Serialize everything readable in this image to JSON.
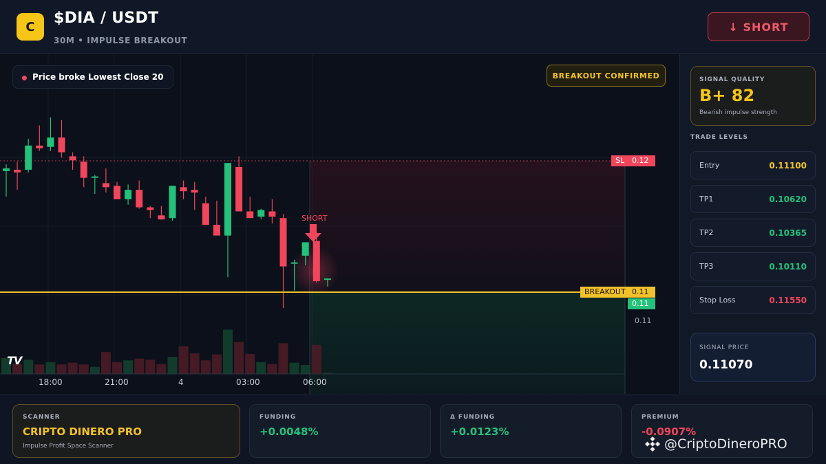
{
  "header": {
    "logo_letter": "C",
    "pair": "$DIA / USDT",
    "subtitle": "30M • IMPULSE BREAKOUT",
    "action_label": "↓ SHORT"
  },
  "chart": {
    "info_text": "Price broke Lowest Close 20",
    "confirm_badge": "BREAKOUT CONFIRMED",
    "sl_name": "SL",
    "sl_value": "0.12",
    "breakout_name": "BREAKOUT",
    "breakout_value": "0.11",
    "current_value": "0.11",
    "axis_value": "0.11",
    "short_marker": "SHORT",
    "tv_logo": "TV",
    "time_labels": [
      "18:00",
      "21:00",
      "4",
      "03:00",
      "06:00"
    ],
    "colors": {
      "up": "#24c17a",
      "down": "#f0465c",
      "breakout": "#f2c22b"
    }
  },
  "chart_data": {
    "type": "candlestick",
    "note_ohlc": "approximate candle and volume values",
    "candles": [
      {
        "o": 0.1159,
        "h": 0.1164,
        "l": 0.114,
        "c": 0.1161
      },
      {
        "o": 0.116,
        "h": 0.1166,
        "l": 0.1145,
        "c": 0.1158
      },
      {
        "o": 0.116,
        "h": 0.1183,
        "l": 0.1158,
        "c": 0.1178
      },
      {
        "o": 0.1178,
        "h": 0.1193,
        "l": 0.1174,
        "c": 0.1176
      },
      {
        "o": 0.1177,
        "h": 0.1199,
        "l": 0.1174,
        "c": 0.1184
      },
      {
        "o": 0.1184,
        "h": 0.1197,
        "l": 0.1169,
        "c": 0.1173
      },
      {
        "o": 0.117,
        "h": 0.1173,
        "l": 0.116,
        "c": 0.1167
      },
      {
        "o": 0.1166,
        "h": 0.117,
        "l": 0.1147,
        "c": 0.1154
      },
      {
        "o": 0.1154,
        "h": 0.1156,
        "l": 0.1142,
        "c": 0.1155
      },
      {
        "o": 0.115,
        "h": 0.1161,
        "l": 0.1143,
        "c": 0.1147
      },
      {
        "o": 0.1148,
        "h": 0.1151,
        "l": 0.1139,
        "c": 0.1138
      },
      {
        "o": 0.1138,
        "h": 0.1149,
        "l": 0.1134,
        "c": 0.1145
      },
      {
        "o": 0.1145,
        "h": 0.1152,
        "l": 0.1131,
        "c": 0.1132
      },
      {
        "o": 0.1132,
        "h": 0.1133,
        "l": 0.1124,
        "c": 0.113
      },
      {
        "o": 0.1126,
        "h": 0.1133,
        "l": 0.1123,
        "c": 0.1123
      },
      {
        "o": 0.1124,
        "h": 0.1142,
        "l": 0.1122,
        "c": 0.1148
      },
      {
        "o": 0.1147,
        "h": 0.1152,
        "l": 0.1138,
        "c": 0.1144
      },
      {
        "o": 0.1145,
        "h": 0.1151,
        "l": 0.113,
        "c": 0.1143
      },
      {
        "o": 0.1135,
        "h": 0.114,
        "l": 0.1119,
        "c": 0.1119
      },
      {
        "o": 0.1119,
        "h": 0.1137,
        "l": 0.1118,
        "c": 0.1111
      },
      {
        "o": 0.1111,
        "h": 0.116,
        "l": 0.108,
        "c": 0.1165
      },
      {
        "o": 0.1162,
        "h": 0.117,
        "l": 0.113,
        "c": 0.1129
      },
      {
        "o": 0.1129,
        "h": 0.114,
        "l": 0.1124,
        "c": 0.1124
      },
      {
        "o": 0.1125,
        "h": 0.1131,
        "l": 0.1123,
        "c": 0.113
      },
      {
        "o": 0.1129,
        "h": 0.1138,
        "l": 0.112,
        "c": 0.1125
      },
      {
        "o": 0.1124,
        "h": 0.1127,
        "l": 0.1057,
        "c": 0.1088
      },
      {
        "o": 0.1091,
        "h": 0.1093,
        "l": 0.107,
        "c": 0.1091
      },
      {
        "o": 0.1096,
        "h": 0.1105,
        "l": 0.1089,
        "c": 0.1106
      },
      {
        "o": 0.1107,
        "h": 0.1114,
        "l": 0.1076,
        "c": 0.1077
      },
      {
        "o": 0.1078,
        "h": 0.1079,
        "l": 0.1073,
        "c": 0.1079
      }
    ],
    "volumes": [
      0.27,
      0.17,
      0.24,
      0.16,
      0.2,
      0.16,
      0.19,
      0.16,
      0.12,
      0.37,
      0.2,
      0.23,
      0.26,
      0.24,
      0.17,
      0.29,
      0.47,
      0.35,
      0.23,
      0.33,
      0.75,
      0.54,
      0.34,
      0.2,
      0.17,
      0.52,
      0.19,
      0.15,
      0.49,
      0.02
    ],
    "sl_level": 0.12,
    "breakout_level": 0.11,
    "time_labels": [
      "18:00",
      "21:00",
      "4",
      "03:00",
      "06:00"
    ]
  },
  "panel": {
    "quality_label": "SIGNAL QUALITY",
    "quality_value": "B+ 82",
    "quality_desc": "Bearish impulse strength",
    "levels_title": "TRADE LEVELS",
    "levels": [
      {
        "name": "Entry",
        "price": "0.11100",
        "color": "#f2c22b"
      },
      {
        "name": "TP1",
        "price": "0.10620",
        "color": "#24c17a"
      },
      {
        "name": "TP2",
        "price": "0.10365",
        "color": "#24c17a"
      },
      {
        "name": "TP3",
        "price": "0.10110",
        "color": "#24c17a"
      },
      {
        "name": "Stop Loss",
        "price": "0.11550",
        "color": "#f0465c"
      }
    ],
    "signal_price_label": "SIGNAL PRICE",
    "signal_price": "0.11070"
  },
  "footer": {
    "scanner_label": "SCANNER",
    "scanner_name": "CRIPTO DINERO PRO",
    "scanner_desc": "Impulse Profit Space Scanner",
    "funding_label": "FUNDING",
    "funding_value": "+0.0048%",
    "dfunding_label": "Δ FUNDING",
    "dfunding_value": "+0.0123%",
    "premium_label": "PREMIUM",
    "premium_value": "-0.0907%",
    "watermark": "@CriptoDineroPRO"
  }
}
